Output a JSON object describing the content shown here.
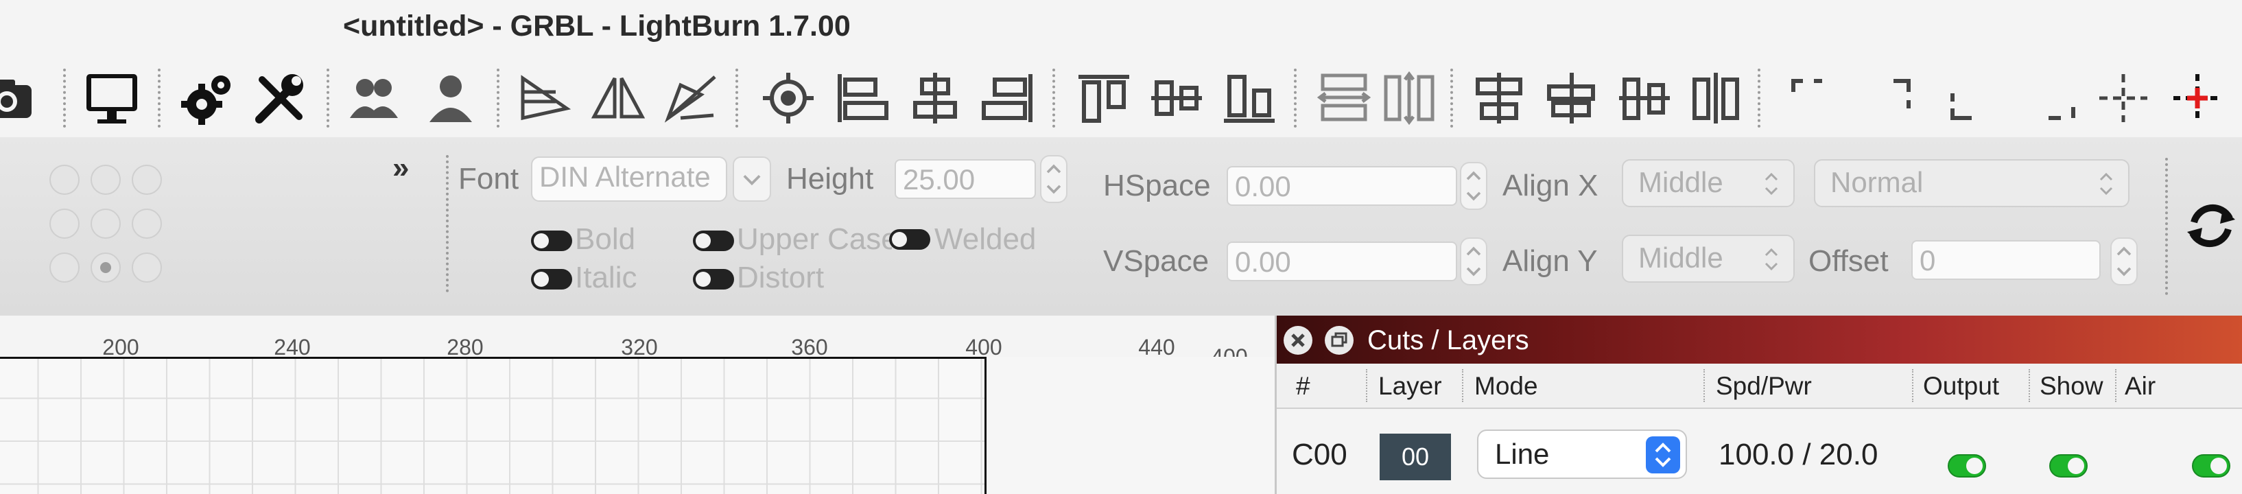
{
  "window": {
    "title": "<untitled> - GRBL - LightBurn 1.7.00"
  },
  "toolbar": {
    "icons": [
      "camera-icon",
      "monitor-icon",
      "settings-gears-icon",
      "tools-icon",
      "users-icon",
      "user-icon",
      "flip-horizontal-icon",
      "mirror-icon",
      "rotate-icon",
      "target-icon",
      "align-left-icon",
      "align-center-h-icon",
      "align-right-icon",
      "align-top-icon",
      "align-middle-v-icon",
      "align-bottom-icon",
      "distribute-h-icon",
      "distribute-v-icon",
      "make-same-width-icon",
      "make-same-height-icon",
      "dock-left-icon",
      "dock-right-icon",
      "corner-top-left-icon",
      "corner-top-right-icon",
      "corner-bottom-left-icon",
      "corner-bottom-right-icon",
      "center-cross-icon",
      "laser-origin-icon"
    ]
  },
  "text_options": {
    "expand_glyph": "»",
    "font_label": "Font",
    "font_value": "DIN Alternate",
    "height_label": "Height",
    "height_value": "25.00",
    "hspace_label": "HSpace",
    "hspace_value": "0.00",
    "vspace_label": "VSpace",
    "vspace_value": "0.00",
    "align_x_label": "Align X",
    "align_x_value": "Middle",
    "align_y_label": "Align Y",
    "align_y_value": "Middle",
    "style_value": "Normal",
    "offset_label": "Offset",
    "offset_value": "0",
    "bold_label": "Bold",
    "italic_label": "Italic",
    "upper_case_label": "Upper Case",
    "distort_label": "Distort",
    "welded_label": "Welded"
  },
  "ruler": {
    "ticks": [
      "200",
      "240",
      "280",
      "320",
      "360",
      "400",
      "440"
    ],
    "side_label": "400"
  },
  "cuts_layers": {
    "title": "Cuts / Layers",
    "columns": [
      "#",
      "Layer",
      "Mode",
      "Spd/Pwr",
      "Output",
      "Show",
      "Air"
    ],
    "rows": [
      {
        "id": "C00",
        "layer": "00",
        "mode": "Line",
        "spd_pwr": "100.0 / 20.0",
        "output": true,
        "show": true,
        "air": true
      }
    ]
  }
}
